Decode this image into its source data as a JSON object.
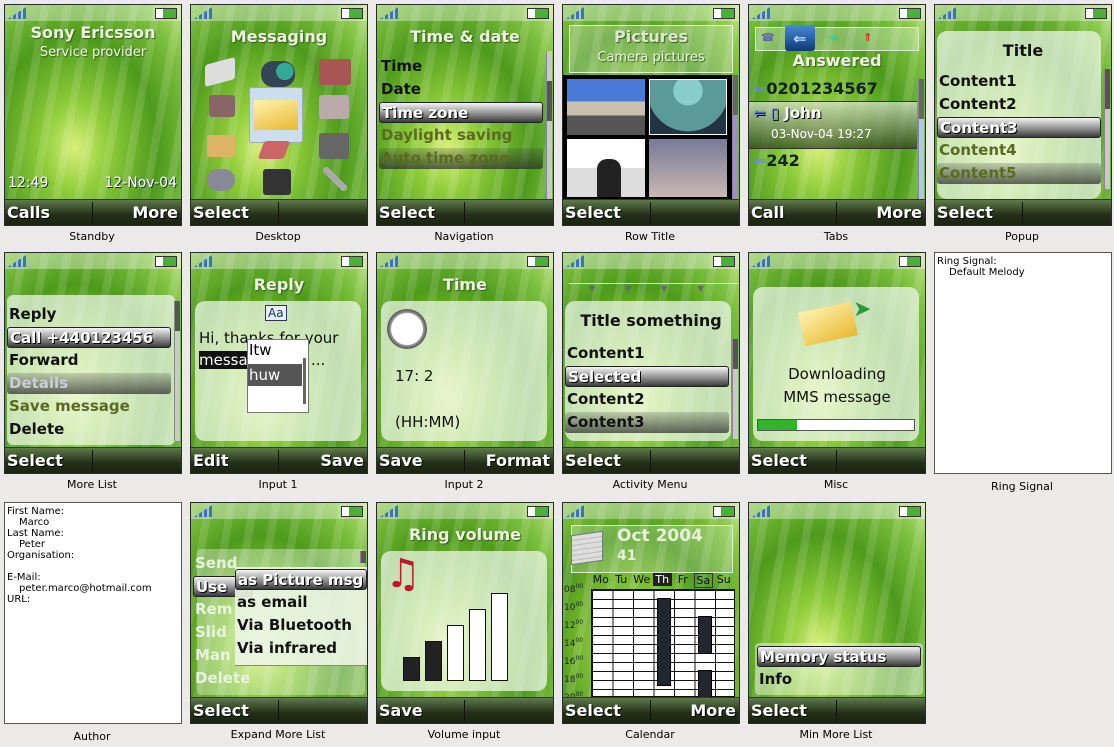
{
  "screens": {
    "standby": {
      "caption": "Standby",
      "brand": "Sony Ericsson",
      "operator": "Service provider",
      "time": "12:49",
      "date": "12-Nov-04",
      "left": "Calls",
      "right": "More"
    },
    "desktop": {
      "caption": "Desktop",
      "title": "Messaging",
      "left": "Select",
      "right": ""
    },
    "navigation": {
      "caption": "Navigation",
      "title": "Time & date",
      "items": [
        "Time",
        "Date",
        "Time zone",
        "Daylight saving",
        "Auto time zone"
      ],
      "left": "Select"
    },
    "row_title": {
      "caption": "Row Title",
      "title": "Pictures",
      "subtitle": "Camera pictures",
      "left": "Select"
    },
    "tabs": {
      "caption": "Tabs",
      "title": "Answered",
      "entries": [
        "0201234567",
        "John",
        "03-Nov-04 19:27",
        "242"
      ],
      "left": "Call",
      "right": "More"
    },
    "popup": {
      "caption": "Popup",
      "title": "Title",
      "items": [
        "Content1",
        "Content2",
        "Content3",
        "Content4",
        "Content5"
      ],
      "left": "Select"
    },
    "more_list": {
      "caption": "More List",
      "items": [
        "Reply",
        "Call +440123456",
        "Forward",
        "Details",
        "Save message",
        "Delete"
      ],
      "left": "Select"
    },
    "input1": {
      "caption": "Input 1",
      "title": "Reply",
      "mode": "Aa",
      "text_line1": "Hi, thanks for your",
      "text_word": "messa",
      "text_rest": "...",
      "suggestions": [
        "Itw",
        "huw"
      ],
      "left": "Edit",
      "right": "Save"
    },
    "input2": {
      "caption": "Input 2",
      "title": "Time",
      "value": "17:  2",
      "format": "(HH:MM)",
      "left": "Save",
      "right": "Format"
    },
    "activity_menu": {
      "caption": "Activity Menu",
      "title": "Title something",
      "items": [
        "Content1",
        "Selected",
        "Content2",
        "Content3"
      ],
      "left": "Select"
    },
    "misc": {
      "caption": "Misc",
      "line1": "Downloading",
      "line2": "MMS message",
      "progress": 0.25,
      "left": "Select"
    },
    "ring_signal": {
      "caption": "Ring Signal",
      "label": "Ring Signal:",
      "value": "Default Melody"
    },
    "author": {
      "caption": "Author",
      "fields": [
        {
          "label": "First Name:",
          "value": "Marco"
        },
        {
          "label": "Last Name:",
          "value": "Peter"
        },
        {
          "label": "Organisation:",
          "value": ""
        },
        {
          "label": "E-Mail:",
          "value": "peter.marco@hotmail.com"
        },
        {
          "label": "URL:",
          "value": ""
        }
      ]
    },
    "expand_more_list": {
      "caption": "Expand More List",
      "items": [
        "Send",
        "Use",
        "Rem",
        "Slid",
        "Man",
        "Delete"
      ],
      "submenu": [
        "as Picture msg",
        "as email",
        "Via Bluetooth",
        "Via infrared"
      ],
      "left": "Select"
    },
    "volume_input": {
      "caption": "Volume input",
      "title": "Ring volume",
      "level": 2,
      "max": 5,
      "left": "Save"
    },
    "calendar": {
      "caption": "Calendar",
      "month": "Oct 2004",
      "week": "41",
      "days": [
        "Mo",
        "Tu",
        "We",
        "Th",
        "Fr",
        "Sa",
        "Su"
      ],
      "today": "Th",
      "hours": [
        "08",
        "10",
        "12",
        "14",
        "16",
        "18",
        "20"
      ],
      "minutes": "00",
      "events": [
        {
          "day": "Th",
          "start": 9,
          "end": 18.5
        },
        {
          "day": "Sa",
          "start": 11,
          "end": 15
        },
        {
          "day": "Sa",
          "start": 17,
          "end": 20
        }
      ],
      "left": "Select",
      "right": "More"
    },
    "min_more_list": {
      "caption": "Min More List",
      "items": [
        "Memory status",
        "Info"
      ],
      "left": "Select"
    }
  },
  "colors": {
    "selected_bar": "#9a9a9a",
    "dim_item": "#5a6a20",
    "softkey_bar": "#233018",
    "progress": "#2fb52a",
    "signal": "#3a6ed0"
  }
}
